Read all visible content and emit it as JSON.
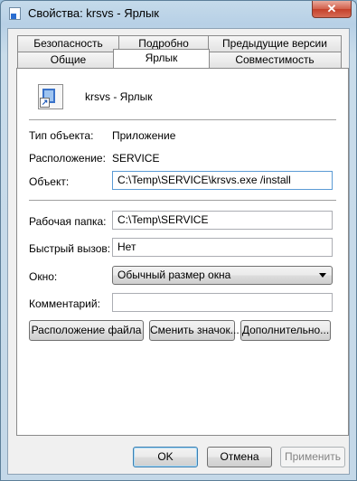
{
  "window": {
    "title": "Свойства: krsvs - Ярлык",
    "close_label": "✕"
  },
  "tabs": {
    "row1": [
      "Безопасность",
      "Подробно",
      "Предыдущие версии"
    ],
    "row2": [
      "Общие",
      "Ярлык",
      "Совместимость"
    ],
    "active": "Ярлык"
  },
  "shortcut": {
    "name": "krsvs - Ярлык",
    "target_type_label": "Тип объекта:",
    "target_type_value": "Приложение",
    "location_label": "Расположение:",
    "location_value": "SERVICE",
    "target_label": "Объект:",
    "target_value": "C:\\Temp\\SERVICE\\krsvs.exe /install",
    "start_in_label": "Рабочая папка:",
    "start_in_value": "C:\\Temp\\SERVICE",
    "hotkey_label": "Быстрый вызов:",
    "hotkey_value": "Нет",
    "run_label": "Окно:",
    "run_value": "Обычный размер окна",
    "comment_label": "Комментарий:",
    "comment_value": ""
  },
  "panel_buttons": {
    "open_location": "Расположение файла",
    "change_icon": "Сменить значок...",
    "advanced": "Дополнительно..."
  },
  "dialog_buttons": {
    "ok": "OK",
    "cancel": "Отмена",
    "apply": "Применить"
  },
  "colors": {
    "accent": "#3c7fb1",
    "close": "#c4402a"
  }
}
